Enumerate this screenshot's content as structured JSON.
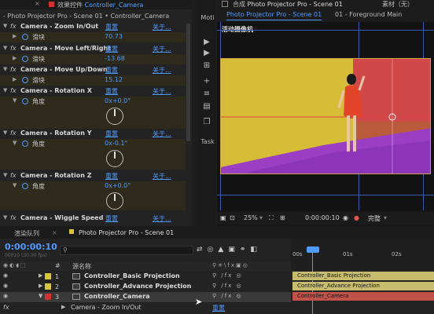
{
  "effect_controls": {
    "tab_title": "效果控件",
    "tab_layer": "Controller_Camera",
    "breadcrumb": "- Photo Projector Pro - Scene 01 • Controller_Camera",
    "reset_label": "重置",
    "about_label": "关于...",
    "effects": [
      {
        "name": "Camera - Zoom In/Out",
        "param": "滑块",
        "value": "70.73"
      },
      {
        "name": "Camera - Move Left/Right",
        "param": "滑块",
        "value": "-13.68"
      },
      {
        "name": "Camera - Move Up/Down",
        "param": "滑块",
        "value": "15.12"
      },
      {
        "name": "Camera - Rotation X",
        "param": "角度",
        "value": "0x+0.0°"
      },
      {
        "name": "Camera - Rotation Y",
        "param": "角度",
        "value": "0x-0.1°"
      },
      {
        "name": "Camera - Rotation Z",
        "param": "角度",
        "value": "0x+0.0°"
      },
      {
        "name": "Camera - Wiggle Speed",
        "param": "",
        "value": ""
      }
    ]
  },
  "side_toolbar": {
    "top_label": "Moti",
    "bottom_label": "Task"
  },
  "composition": {
    "tab_label": "合成",
    "tab_title": "Photo Projector Pro - Scene 01",
    "material_label": "素材（无）",
    "subtab_active": "Photo Projector Pro - Scene 01",
    "subtab_other": "01 - Foreground Main",
    "camera_label": "活动摄像机",
    "zoom": "25%",
    "timecode": "0:00:00:10",
    "quality": "完整"
  },
  "timeline": {
    "render_queue_tab": "渲染队列",
    "comp_tab": "Photo Projector Pro - Scene 01",
    "timecode": "0:00:00:10",
    "fps": "00010 (30.00 fps)",
    "search_placeholder": "",
    "col_num": "#",
    "col_source": "源名称",
    "ruler": [
      "00s",
      "01s",
      "02s"
    ],
    "layers": [
      {
        "num": "1",
        "name": "Controller_Basic Projection",
        "color": "#d8c437",
        "bar": "Controller_Basic Projection",
        "bar_color": "#c8bd6e"
      },
      {
        "num": "2",
        "name": "Controller_Advance Projection",
        "color": "#d8c437",
        "bar": "Controller_Advance Projection",
        "bar_color": "#c8bd6e"
      },
      {
        "num": "3",
        "name": "Controller_Camera",
        "color": "#d43030",
        "bar": "Controller_Camera",
        "bar_color": "#c0524a"
      }
    ],
    "sub_effect": "Camera - Zoom In/Out",
    "sub_reset": "重置"
  },
  "colors": {
    "accent": "#4f9bff",
    "layer_red": "#d43030",
    "layer_yellow": "#d8c437"
  }
}
